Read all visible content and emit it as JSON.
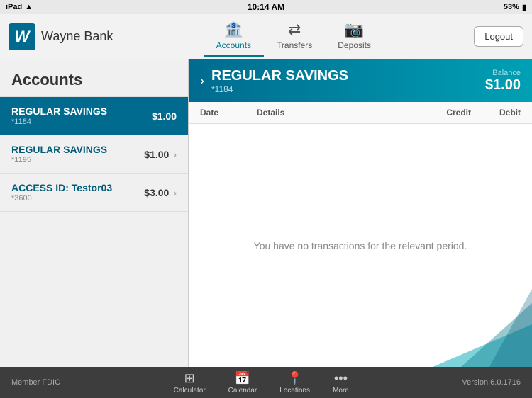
{
  "statusBar": {
    "left": "iPad",
    "wifi": "WiFi",
    "time": "10:14 AM",
    "battery": "53%"
  },
  "header": {
    "bankName": "Wayne Bank",
    "logoLetter": "W",
    "logoutLabel": "Logout"
  },
  "navTabs": [
    {
      "id": "accounts",
      "label": "Accounts",
      "icon": "🏦",
      "active": true
    },
    {
      "id": "transfers",
      "label": "Transfers",
      "icon": "↔",
      "active": false
    },
    {
      "id": "deposits",
      "label": "Deposits",
      "icon": "📷",
      "active": false
    }
  ],
  "sidebar": {
    "title": "Accounts",
    "accounts": [
      {
        "id": "acc1",
        "name": "REGULAR SAVINGS",
        "num": "*1184",
        "balance": "$1.00",
        "active": true
      },
      {
        "id": "acc2",
        "name": "REGULAR SAVINGS",
        "num": "*1195",
        "balance": "$1.00 ›",
        "active": false
      },
      {
        "id": "acc3",
        "name": "ACCESS ID: Testor03",
        "num": "*3600",
        "balance": "$3.00 ›",
        "active": false
      }
    ]
  },
  "detail": {
    "accountName": "REGULAR SAVINGS",
    "accountNum": "*1184",
    "balanceLabel": "Balance",
    "balanceAmount": "$1.00",
    "columns": {
      "date": "Date",
      "details": "Details",
      "credit": "Credit",
      "debit": "Debit"
    },
    "noTransactionsMsg": "You have no transactions for the relevant period."
  },
  "bottomBar": {
    "memberText": "Member FDIC",
    "versionText": "Version 6.0.1716",
    "tabs": [
      {
        "id": "calculator",
        "label": "Calculator",
        "icon": "⊞"
      },
      {
        "id": "calendar",
        "label": "Calendar",
        "icon": "📅"
      },
      {
        "id": "locations",
        "label": "Locations",
        "icon": "📍"
      },
      {
        "id": "more",
        "label": "More",
        "icon": "···"
      }
    ]
  }
}
